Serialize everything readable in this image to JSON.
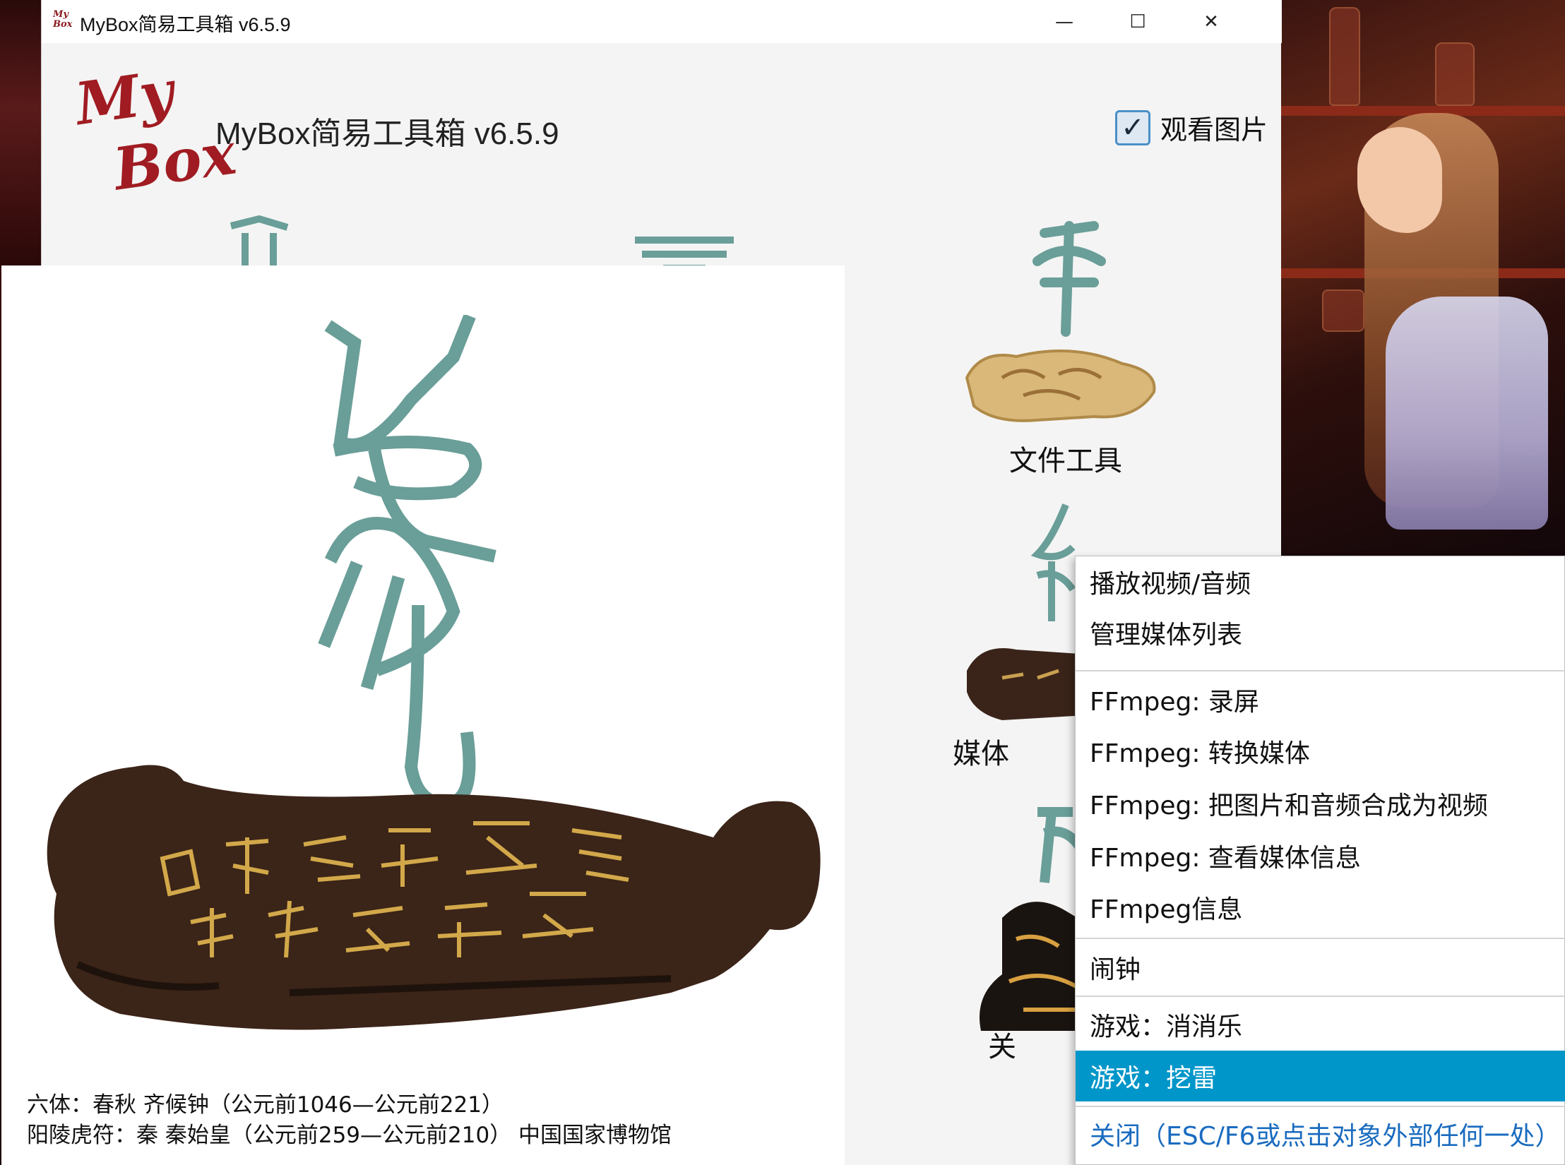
{
  "window": {
    "title": "MyBox简易工具箱 v6.5.9",
    "icon_text": "My Box",
    "minimize_glyph": "—",
    "maximize_glyph": "☐",
    "close_glyph": "✕"
  },
  "header": {
    "logo_line1": "My",
    "logo_line2": "Box",
    "app_title": "MyBox简易工具箱 v6.5.9",
    "view_images_label": "观看图片",
    "view_images_checked": true
  },
  "tools": [
    {
      "label": "文件工具"
    },
    {
      "label": "媒体"
    },
    {
      "label": "关"
    }
  ],
  "image_popup": {
    "caption_line1": "六体：春秋 齐候钟（公元前1046—公元前221）",
    "caption_line2": "阳陵虎符：秦 秦始皇（公元前259—公元前210） 中国国家博物馆"
  },
  "context_menu": {
    "items": [
      {
        "label": "播放视频/音频"
      },
      {
        "label": "管理媒体列表"
      },
      {
        "label": "FFmpeg: 录屏"
      },
      {
        "label": "FFmpeg: 转换媒体"
      },
      {
        "label": "FFmpeg: 把图片和音频合成为视频"
      },
      {
        "label": "FFmpeg: 查看媒体信息"
      },
      {
        "label": "FFmpeg信息"
      },
      {
        "label": "闹钟"
      },
      {
        "label": "游戏：消消乐"
      },
      {
        "label": "游戏：挖雷"
      }
    ],
    "selected_index": 9,
    "close_label": "关闭（ESC/F6或点击对象外部任何一处）"
  },
  "colors": {
    "selected_bg": "#0096c9",
    "glyph_teal": "#6a9e98",
    "logo_red": "#a01c22",
    "close_link": "#1a6bbf"
  }
}
